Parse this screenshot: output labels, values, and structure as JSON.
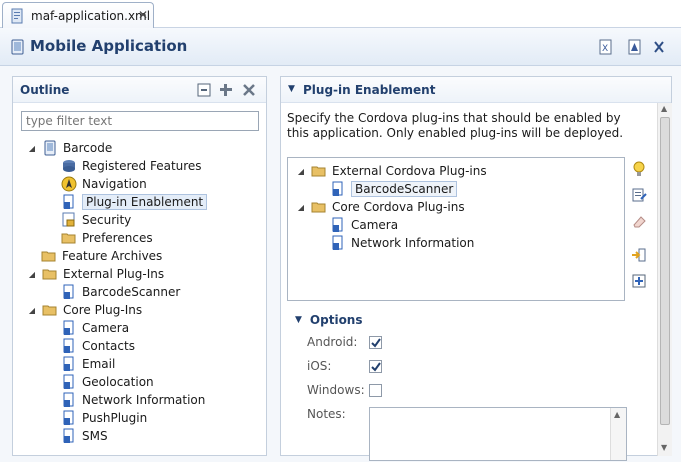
{
  "editor_tab": {
    "label": "maf-application.xml",
    "close": "✕"
  },
  "header": {
    "title": "Mobile Application"
  },
  "outline": {
    "title": "Outline",
    "filter_placeholder": "type filter text",
    "items": [
      {
        "label": "Barcode",
        "icon": "phone-icon"
      },
      {
        "label": "Registered Features",
        "icon": "features-icon"
      },
      {
        "label": "Navigation",
        "icon": "navigation-icon"
      },
      {
        "label": "Plug-in Enablement",
        "icon": "plugin-icon"
      },
      {
        "label": "Security",
        "icon": "lock-icon"
      },
      {
        "label": "Preferences",
        "icon": "folder-icon"
      },
      {
        "label": "Feature Archives",
        "icon": "folder-icon"
      },
      {
        "label": "External Plug-Ins",
        "icon": "folder-icon"
      },
      {
        "label": "BarcodeScanner",
        "icon": "plugin-icon"
      },
      {
        "label": "Core Plug-Ins",
        "icon": "folder-icon"
      },
      {
        "label": "Camera",
        "icon": "plugin-icon"
      },
      {
        "label": "Contacts",
        "icon": "plugin-icon"
      },
      {
        "label": "Email",
        "icon": "plugin-icon"
      },
      {
        "label": "Geolocation",
        "icon": "plugin-icon"
      },
      {
        "label": "Network Information",
        "icon": "plugin-icon"
      },
      {
        "label": "PushPlugin",
        "icon": "plugin-icon"
      },
      {
        "label": "SMS",
        "icon": "plugin-icon"
      }
    ]
  },
  "plugin_section": {
    "title": "Plug-in Enablement",
    "description": "Specify the Cordova plug-ins that should be enabled by this application.  Only enabled plug-ins will be deployed.",
    "tree": [
      {
        "label": "External Cordova Plug-ins"
      },
      {
        "label": "BarcodeScanner"
      },
      {
        "label": "Core Cordova Plug-ins"
      },
      {
        "label": "Camera"
      },
      {
        "label": "Network Information"
      }
    ]
  },
  "options": {
    "title": "Options",
    "android_label": "Android:",
    "android_checked": true,
    "ios_label": "iOS:",
    "ios_checked": true,
    "windows_label": "Windows:",
    "windows_checked": false,
    "notes_label": "Notes:",
    "notes_value": ""
  },
  "colors": {
    "accent": "#22406e",
    "folder": "#e8c065",
    "plugin": "#2f63b8"
  }
}
